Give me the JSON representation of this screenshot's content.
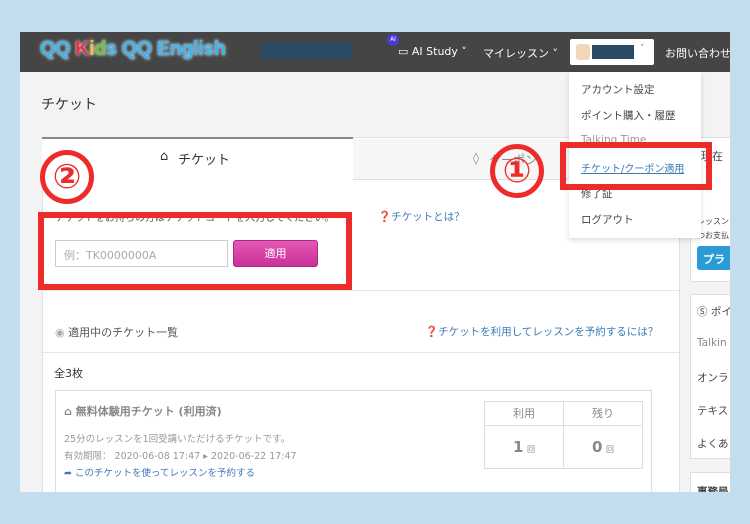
{
  "nav": {
    "logo": "QQ Kids QQ English",
    "ai_badge": "AI",
    "ai_study": "AI Study",
    "my_lessons": "マイレッスン",
    "contact": "お問い合わせ"
  },
  "dropdown": {
    "items": [
      "アカウント設定",
      "ポイント購入・履歴",
      "Talking Time",
      "チケット/クーポン適用",
      "修了証",
      "ログアウト"
    ]
  },
  "page": {
    "title": "チケット",
    "tab_ticket": "チケット",
    "tab_coupon": "クーポン",
    "instruction": "チケットをお持ちの方はチケットコードを入力してください。",
    "what_is_ticket": "チケットとは？",
    "input_placeholder": "例：TK0000000A",
    "apply_button": "適用"
  },
  "annotations": {
    "step1": "①",
    "step2": "②"
  },
  "list": {
    "header": "適用中のチケット一覧",
    "help_link": "チケットを利用してレッスンを予約するには？",
    "count": "全3枚"
  },
  "ticket": {
    "name": "無料体験用チケット (利用済)",
    "desc": "25分のレッスンを1回受講いただけるチケットです。",
    "validity_label": "有効期限：",
    "valid_from": "2020-06-08 17:47",
    "valid_to": "2020-06-22 17:47",
    "book_link": "このチケットを使ってレッスンを予約する",
    "col_used": "利用",
    "col_left": "残り",
    "used": "1",
    "left": "0",
    "unit": "回"
  },
  "sidebar": {
    "current": "現在",
    "text1": "レッスン",
    "text2": "わお支払",
    "plan_button": "プラ",
    "points": "ポイ",
    "talking": "Talkin",
    "online": "オンラ",
    "text": "テキス",
    "faq": "よくあ",
    "office": "事務局"
  },
  "colors": {
    "accent": "#d63ba6",
    "annotation": "#ee2b2b",
    "nav": "#454545"
  }
}
